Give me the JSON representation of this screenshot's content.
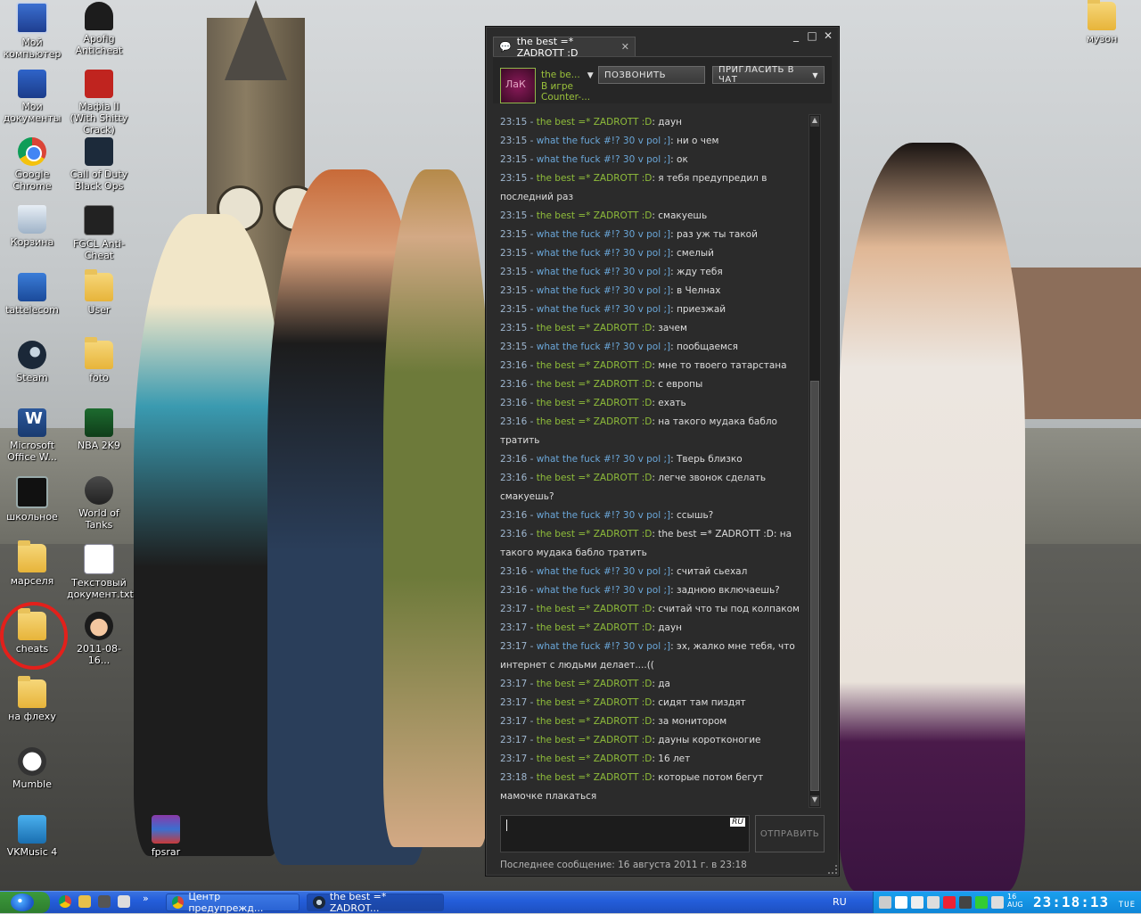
{
  "desktop": {
    "icons_left": [
      {
        "label": "Мой компьютер",
        "icon": "computer-icon"
      },
      {
        "label": "Мои документы",
        "icon": "documents-icon"
      },
      {
        "label": "Google Chrome",
        "icon": "chrome-icon"
      },
      {
        "label": "Корзина",
        "icon": "recycle-bin-icon"
      },
      {
        "label": "tattelecom",
        "icon": "network-icon"
      },
      {
        "label": "Steam",
        "icon": "steam-icon"
      },
      {
        "label": "Microsoft Office W...",
        "icon": "word-icon"
      },
      {
        "label": "школьное",
        "icon": "terminal-icon"
      },
      {
        "label": "марселя",
        "icon": "folder-icon"
      },
      {
        "label": "cheats",
        "icon": "folder-icon"
      },
      {
        "label": "на флеху",
        "icon": "folder-icon"
      },
      {
        "label": "Mumble",
        "icon": "mumble-icon"
      },
      {
        "label": "VKMusic 4",
        "icon": "vkmusic-icon"
      }
    ],
    "icons_col2": [
      {
        "label": "Apofig Anticheat",
        "icon": "anticheat-icon"
      },
      {
        "label": "Мафіа ІІ (With Shitty Crack)",
        "icon": "mafia-icon"
      },
      {
        "label": "Call of Duty Black Ops",
        "icon": "cod-icon"
      },
      {
        "label": "FGCL Anti-Cheat",
        "icon": "fgcl-icon"
      },
      {
        "label": "User",
        "icon": "folder-icon"
      },
      {
        "label": "foto",
        "icon": "folder-icon"
      },
      {
        "label": "NBA 2K9",
        "icon": "nba-icon"
      },
      {
        "label": "World of Tanks",
        "icon": "wot-icon"
      },
      {
        "label": "Текстовый документ.txt",
        "icon": "text-file-icon"
      },
      {
        "label": "2011-08-16...",
        "icon": "image-file-icon"
      },
      {
        "label": "fpsrar",
        "icon": "rar-icon"
      }
    ],
    "icon_right": {
      "label": "музон",
      "icon": "folder-icon"
    }
  },
  "chat": {
    "tab_title": "the best =* ZADROTT :D",
    "buddy": {
      "name": "the be...",
      "status": "В игре",
      "game": "Counter-...",
      "avatar_text": "ЛаК"
    },
    "call_label": "ПОЗВОНИТЬ",
    "invite_label": "ПРИГЛАСИТЬ В ЧАТ",
    "send_label": "ОТПРАВИТЬ",
    "input_lang": "RU",
    "last_message": "Последнее сообщение: 16 августа 2011 г. в 23:18",
    "messages": [
      {
        "time": "23:15",
        "who": "the best =* ZADROTT :D",
        "text": "даун"
      },
      {
        "time": "23:15",
        "who": "what the fuck #!? 30 v pol ;]",
        "text": "ни о чем"
      },
      {
        "time": "23:15",
        "who": "what the fuck #!? 30 v pol ;]",
        "text": "ок"
      },
      {
        "time": "23:15",
        "who": "the best =* ZADROTT :D",
        "text": "я тебя предупредил в последний раз"
      },
      {
        "time": "23:15",
        "who": "the best =* ZADROTT :D",
        "text": "смакуешь"
      },
      {
        "time": "23:15",
        "who": "what the fuck #!? 30 v pol ;]",
        "text": "раз уж ты такой"
      },
      {
        "time": "23:15",
        "who": "what the fuck #!? 30 v pol ;]",
        "text": "смелый"
      },
      {
        "time": "23:15",
        "who": "what the fuck #!? 30 v pol ;]",
        "text": "жду тебя"
      },
      {
        "time": "23:15",
        "who": "what the fuck #!? 30 v pol ;]",
        "text": "в Челнах"
      },
      {
        "time": "23:15",
        "who": "what the fuck #!? 30 v pol ;]",
        "text": "приезжай"
      },
      {
        "time": "23:15",
        "who": "the best =* ZADROTT :D",
        "text": "зачем"
      },
      {
        "time": "23:15",
        "who": "what the fuck #!? 30 v pol ;]",
        "text": "пообщаемся"
      },
      {
        "time": "23:16",
        "who": "the best =* ZADROTT :D",
        "text": "мне то твоего татарстана"
      },
      {
        "time": "23:16",
        "who": "the best =* ZADROTT :D",
        "text": "с европы"
      },
      {
        "time": "23:16",
        "who": "the best =* ZADROTT :D",
        "text": "ехать"
      },
      {
        "time": "23:16",
        "who": "the best =* ZADROTT :D",
        "text": "на такого мудака бабло тратить"
      },
      {
        "time": "23:16",
        "who": "what the fuck #!? 30 v pol ;]",
        "text": "Тверь близко"
      },
      {
        "time": "23:16",
        "who": "the best =* ZADROTT :D",
        "text": "легче звонок сделать смакуешь?"
      },
      {
        "time": "23:16",
        "who": "what the fuck #!? 30 v pol ;]",
        "text": "ссышь?"
      },
      {
        "time": "23:16",
        "who": "the best =* ZADROTT :D",
        "text": "the best =* ZADROTT :D: на такого мудака бабло тратить"
      },
      {
        "time": "23:16",
        "who": "what the fuck #!? 30 v pol ;]",
        "text": "считай сьехал"
      },
      {
        "time": "23:16",
        "who": "what the fuck #!? 30 v pol ;]",
        "text": "заднюю включаешь?"
      },
      {
        "time": "23:17",
        "who": "the best =* ZADROTT :D",
        "text": "считай что ты под колпаком"
      },
      {
        "time": "23:17",
        "who": "the best =* ZADROTT :D",
        "text": "даун"
      },
      {
        "time": "23:17",
        "who": "what the fuck #!? 30 v pol ;]",
        "text": "эх, жалко мне тебя, что интернет с людьми делает....(("
      },
      {
        "time": "23:17",
        "who": "the best =* ZADROTT :D",
        "text": "да"
      },
      {
        "time": "23:17",
        "who": "the best =* ZADROTT :D",
        "text": "сидят там пиздят"
      },
      {
        "time": "23:17",
        "who": "the best =* ZADROTT :D",
        "text": "за монитором"
      },
      {
        "time": "23:17",
        "who": "the best =* ZADROTT :D",
        "text": "дауны коротконогие"
      },
      {
        "time": "23:17",
        "who": "the best =* ZADROTT :D",
        "text": "16 лет"
      },
      {
        "time": "23:18",
        "who": "the best =* ZADROTT :D",
        "text": "которые потом бегут мамочке плакаться"
      }
    ],
    "colors": {
      "self": "#8fbd3a",
      "other": "#6aa6d8",
      "time": "#9fb7d0"
    }
  },
  "taskbar": {
    "buttons": [
      {
        "label": "Центр предупрежд...",
        "icon": "chrome-icon"
      },
      {
        "label": "the best =* ZADROT...",
        "icon": "steam-icon"
      }
    ],
    "lang": "RU",
    "date_day": "16",
    "date_month": "AUG",
    "time": "23:18:13",
    "weekday": "TUE"
  }
}
